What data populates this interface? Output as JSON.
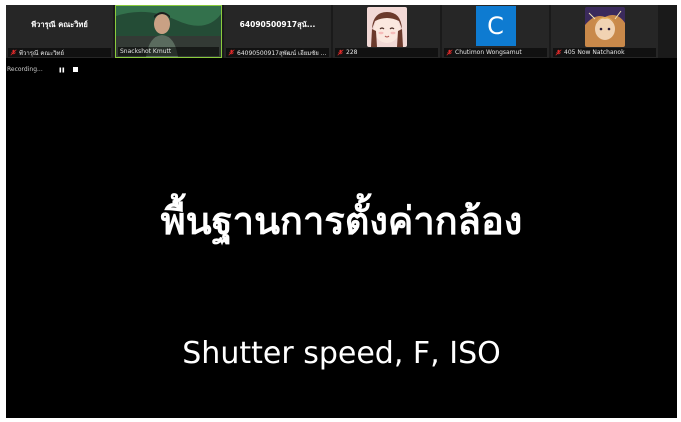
{
  "participants": [
    {
      "display_name": "พีวารุณี คณะวิทย์",
      "name_label": "พีวารุณี คณะวิทย์",
      "muted": true,
      "type": "name"
    },
    {
      "display_name": "",
      "name_label": "Snackshot Kmutt",
      "muted": false,
      "type": "video"
    },
    {
      "display_name": "64090500917สุนั...",
      "name_label": "64090500917สุพัฒน์ เอียมชัย คณ...",
      "muted": true,
      "type": "name"
    },
    {
      "display_name": "",
      "name_label": "228",
      "muted": true,
      "type": "image"
    },
    {
      "display_name": "C",
      "name_label": "Chutimon Wongsamut",
      "muted": true,
      "type": "letter",
      "avatar_color": "#0e7bd1"
    },
    {
      "display_name": "",
      "name_label": "405 Now Natchanok",
      "muted": true,
      "type": "image"
    }
  ],
  "recording": {
    "label": "Recording...",
    "pause_icon": "pause-icon",
    "stop_icon": "stop-icon"
  },
  "slide": {
    "title": "พื้นฐานการตั้งค่ากล้อง",
    "subtitle": "Shutter speed, F, ISO"
  },
  "colors": {
    "background": "#000000",
    "active_speaker_border": "#8acb3d",
    "muted_icon": "#e02a2a",
    "avatar_blue": "#0e7bd1"
  }
}
